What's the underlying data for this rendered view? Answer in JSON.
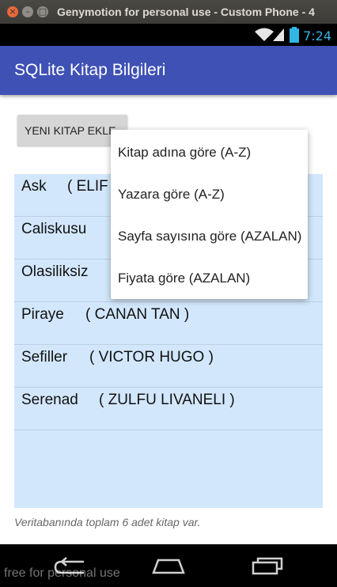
{
  "window": {
    "title": "Genymotion for personal use - Custom Phone - 4",
    "close_glyph": "×",
    "min_glyph": "–",
    "max_glyph": "□"
  },
  "statusbar": {
    "time": "7:24",
    "icons": [
      "wifi-icon",
      "signal-icon",
      "battery-icon"
    ]
  },
  "actionbar": {
    "title": "SQLite Kitap Bilgileri",
    "color": "#3f51b5"
  },
  "add_button": {
    "label": "YENI KITAP EKLE"
  },
  "books": [
    {
      "name": "Ask",
      "author": "( ELIF"
    },
    {
      "name": "Caliskusu",
      "author": ""
    },
    {
      "name": "Olasiliksiz",
      "author": ""
    },
    {
      "name": "Piraye",
      "author": "( CANAN TAN )"
    },
    {
      "name": "Sefiller",
      "author": "( VICTOR HUGO )"
    },
    {
      "name": "Serenad",
      "author": "( ZULFU LIVANELI )"
    }
  ],
  "footer": {
    "text": "Veritabanında toplam 6 adet kitap var."
  },
  "sort_menu": {
    "items": [
      "Kitap adına göre (A-Z)",
      "Yazara göre (A-Z)",
      "Sayfa sayısına göre (AZALAN)",
      "Fiyata göre (AZALAN)"
    ]
  },
  "navbar": {
    "buttons": [
      "back-icon",
      "home-icon",
      "recents-icon"
    ]
  },
  "watermark": "free for personal use"
}
